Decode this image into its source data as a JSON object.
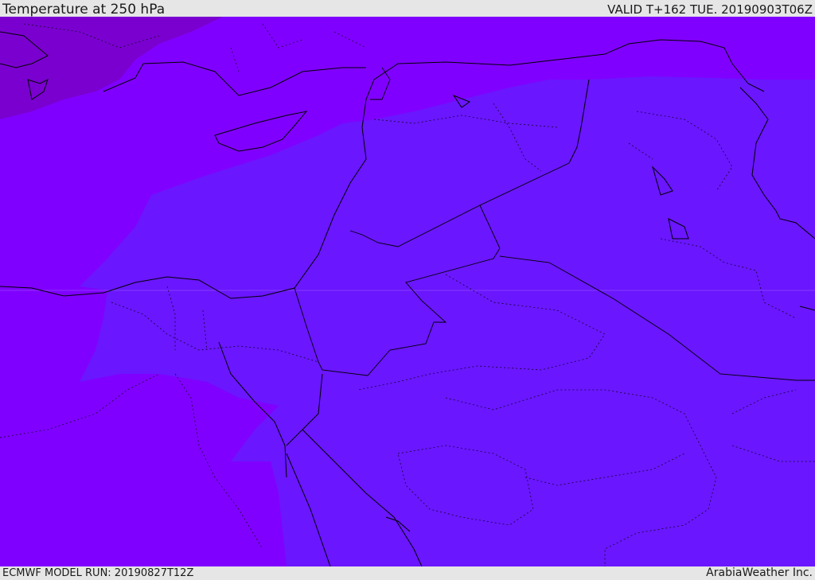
{
  "header": {
    "title": "Temperature at 250 hPa",
    "valid_time": "VALID T+162 TUE. 20190903T06Z"
  },
  "footer": {
    "model_run": "ECMWF MODEL RUN: 20190827T12Z",
    "credit": "ArabiaWeather Inc."
  },
  "map": {
    "variable": "temperature",
    "pressure_level_hpa": 250,
    "colors": {
      "coldest_zone": "#7a00d0",
      "cold_zone": "#8000ff",
      "mid_zone": "#6a16ff",
      "boundary_line": "#000000"
    }
  }
}
